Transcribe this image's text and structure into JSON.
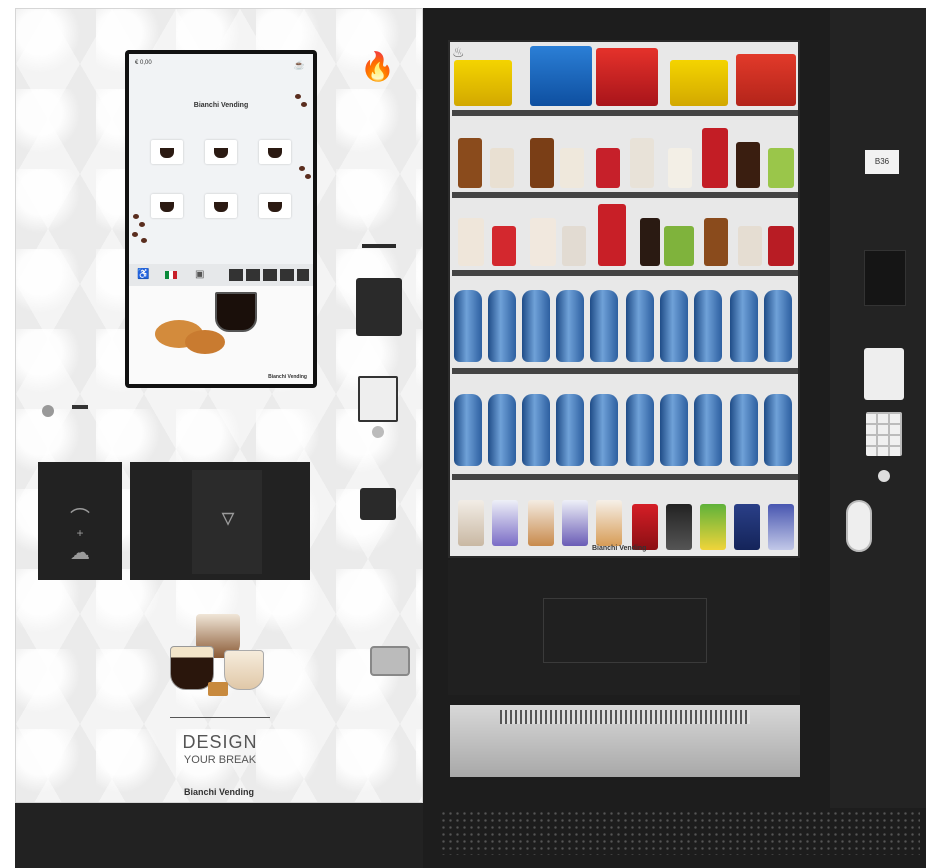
{
  "coffee_machine": {
    "screen": {
      "price_display": "€ 0,00",
      "brand": "Bianchi Vending",
      "promo_brand": "Bianchi Vending"
    },
    "slogan_line1": "DESIGN",
    "slogan_line2": "YOUR BREAK",
    "brand_plate": "Bianchi Vending",
    "logo_icon": "flame-logo-icon"
  },
  "snack_machine": {
    "glass_brand": "Bianchi Vending",
    "side_label": "B36",
    "shelves": [
      {
        "row": 1,
        "items": [
          "chips",
          "chips",
          "chips",
          "chips",
          "chips"
        ]
      },
      {
        "row": 2,
        "items": [
          "candy-bar",
          "candy-bar",
          "candy-bar",
          "candy-bar",
          "candy-bar",
          "candy-bar",
          "candy-bar",
          "candy-bar",
          "candy-bar",
          "candy-bar"
        ]
      },
      {
        "row": 3,
        "items": [
          "candy-bar",
          "candy-bar",
          "candy-bar",
          "candy-bar",
          "candy-bar",
          "candy-bar",
          "candy-bar",
          "candy-bar",
          "candy-bar",
          "candy-bar"
        ]
      },
      {
        "row": 4,
        "items": [
          "water-bottle",
          "water-bottle",
          "water-bottle",
          "water-bottle",
          "water-bottle",
          "water-bottle",
          "water-bottle",
          "water-bottle",
          "water-bottle",
          "water-bottle"
        ]
      },
      {
        "row": 5,
        "items": [
          "water-bottle",
          "water-bottle",
          "water-bottle",
          "water-bottle",
          "water-bottle",
          "water-bottle",
          "water-bottle",
          "water-bottle",
          "water-bottle",
          "water-bottle"
        ]
      },
      {
        "row": 6,
        "items": [
          "milk-drink",
          "milk-drink",
          "milk-drink",
          "milk-drink",
          "milk-drink",
          "can",
          "can",
          "can",
          "can",
          "can"
        ]
      }
    ]
  }
}
